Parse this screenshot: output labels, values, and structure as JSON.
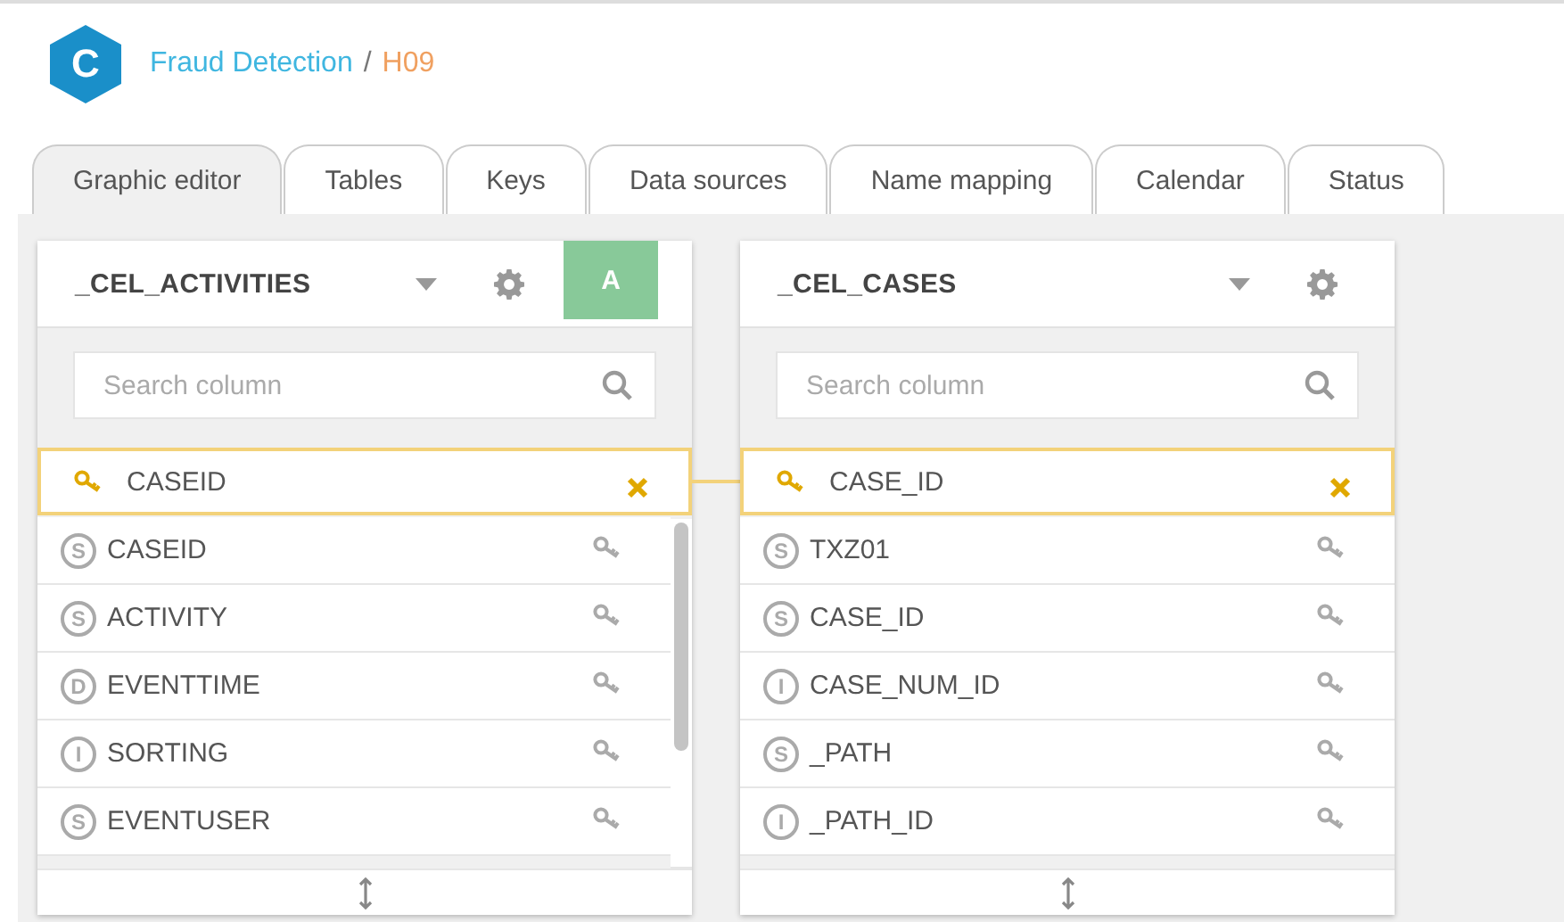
{
  "logo": {
    "letter": "C"
  },
  "breadcrumb": [
    {
      "label": "Fraud Detection",
      "kind": "link"
    },
    {
      "label": "/",
      "kind": "separator"
    },
    {
      "label": "H09",
      "kind": "current"
    }
  ],
  "tabs": [
    {
      "label": "Graphic editor",
      "selected": true
    },
    {
      "label": "Tables",
      "selected": false
    },
    {
      "label": "Keys",
      "selected": false
    },
    {
      "label": "Data sources",
      "selected": false
    },
    {
      "label": "Name mapping",
      "selected": false
    },
    {
      "label": "Calendar",
      "selected": false
    },
    {
      "label": "Status",
      "selected": false
    }
  ],
  "tables": [
    {
      "name": "_CEL_ACTIVITIES",
      "badge": "A",
      "search": {
        "placeholder": "Search column"
      },
      "scrollable": true,
      "columns": [
        {
          "kind": "key",
          "name": "CASEID"
        },
        {
          "kind": "column",
          "type": "S",
          "name": "CASEID"
        },
        {
          "kind": "column",
          "type": "S",
          "name": "ACTIVITY"
        },
        {
          "kind": "column",
          "type": "D",
          "name": "EVENTTIME"
        },
        {
          "kind": "column",
          "type": "I",
          "name": "SORTING"
        },
        {
          "kind": "column",
          "type": "S",
          "name": "EVENTUSER"
        }
      ]
    },
    {
      "name": "_CEL_CASES",
      "search": {
        "placeholder": "Search column"
      },
      "scrollable": false,
      "columns": [
        {
          "kind": "key",
          "name": "CASE_ID"
        },
        {
          "kind": "column",
          "type": "S",
          "name": "TXZ01"
        },
        {
          "kind": "column",
          "type": "S",
          "name": "CASE_ID"
        },
        {
          "kind": "column",
          "type": "I",
          "name": "CASE_NUM_ID"
        },
        {
          "kind": "column",
          "type": "S",
          "name": "_PATH"
        },
        {
          "kind": "column",
          "type": "I",
          "name": "_PATH_ID"
        }
      ]
    }
  ]
}
